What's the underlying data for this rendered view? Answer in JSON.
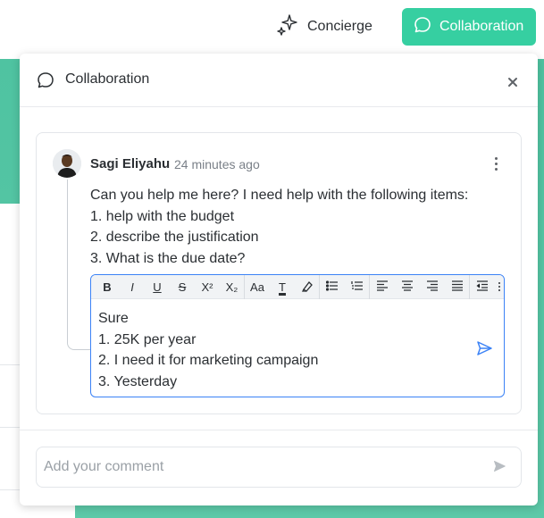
{
  "topbar": {
    "concierge_label": "Concierge",
    "collaboration_label": "Collaboration"
  },
  "panel": {
    "title": "Collaboration"
  },
  "comment": {
    "author": "Sagi Eliyahu",
    "timestamp": "24 minutes ago",
    "lines": [
      "Can you help me here? I need help with the following items:",
      "1. help with the budget",
      "2. describe the justification",
      "3. What is the due date?"
    ]
  },
  "editor": {
    "toolbar": [
      "B",
      "I",
      "U",
      "S",
      "X²",
      "X₂",
      "Aa",
      "T"
    ],
    "lines": [
      "Sure",
      "1. 25K per year",
      "2. I need it for marketing campaign",
      "3. Yesterday"
    ]
  },
  "footer": {
    "placeholder": "Add your comment"
  },
  "colors": {
    "accent": "#36cfa1",
    "editor_border": "#3b82f6",
    "background_app": "#4fc3a1"
  }
}
